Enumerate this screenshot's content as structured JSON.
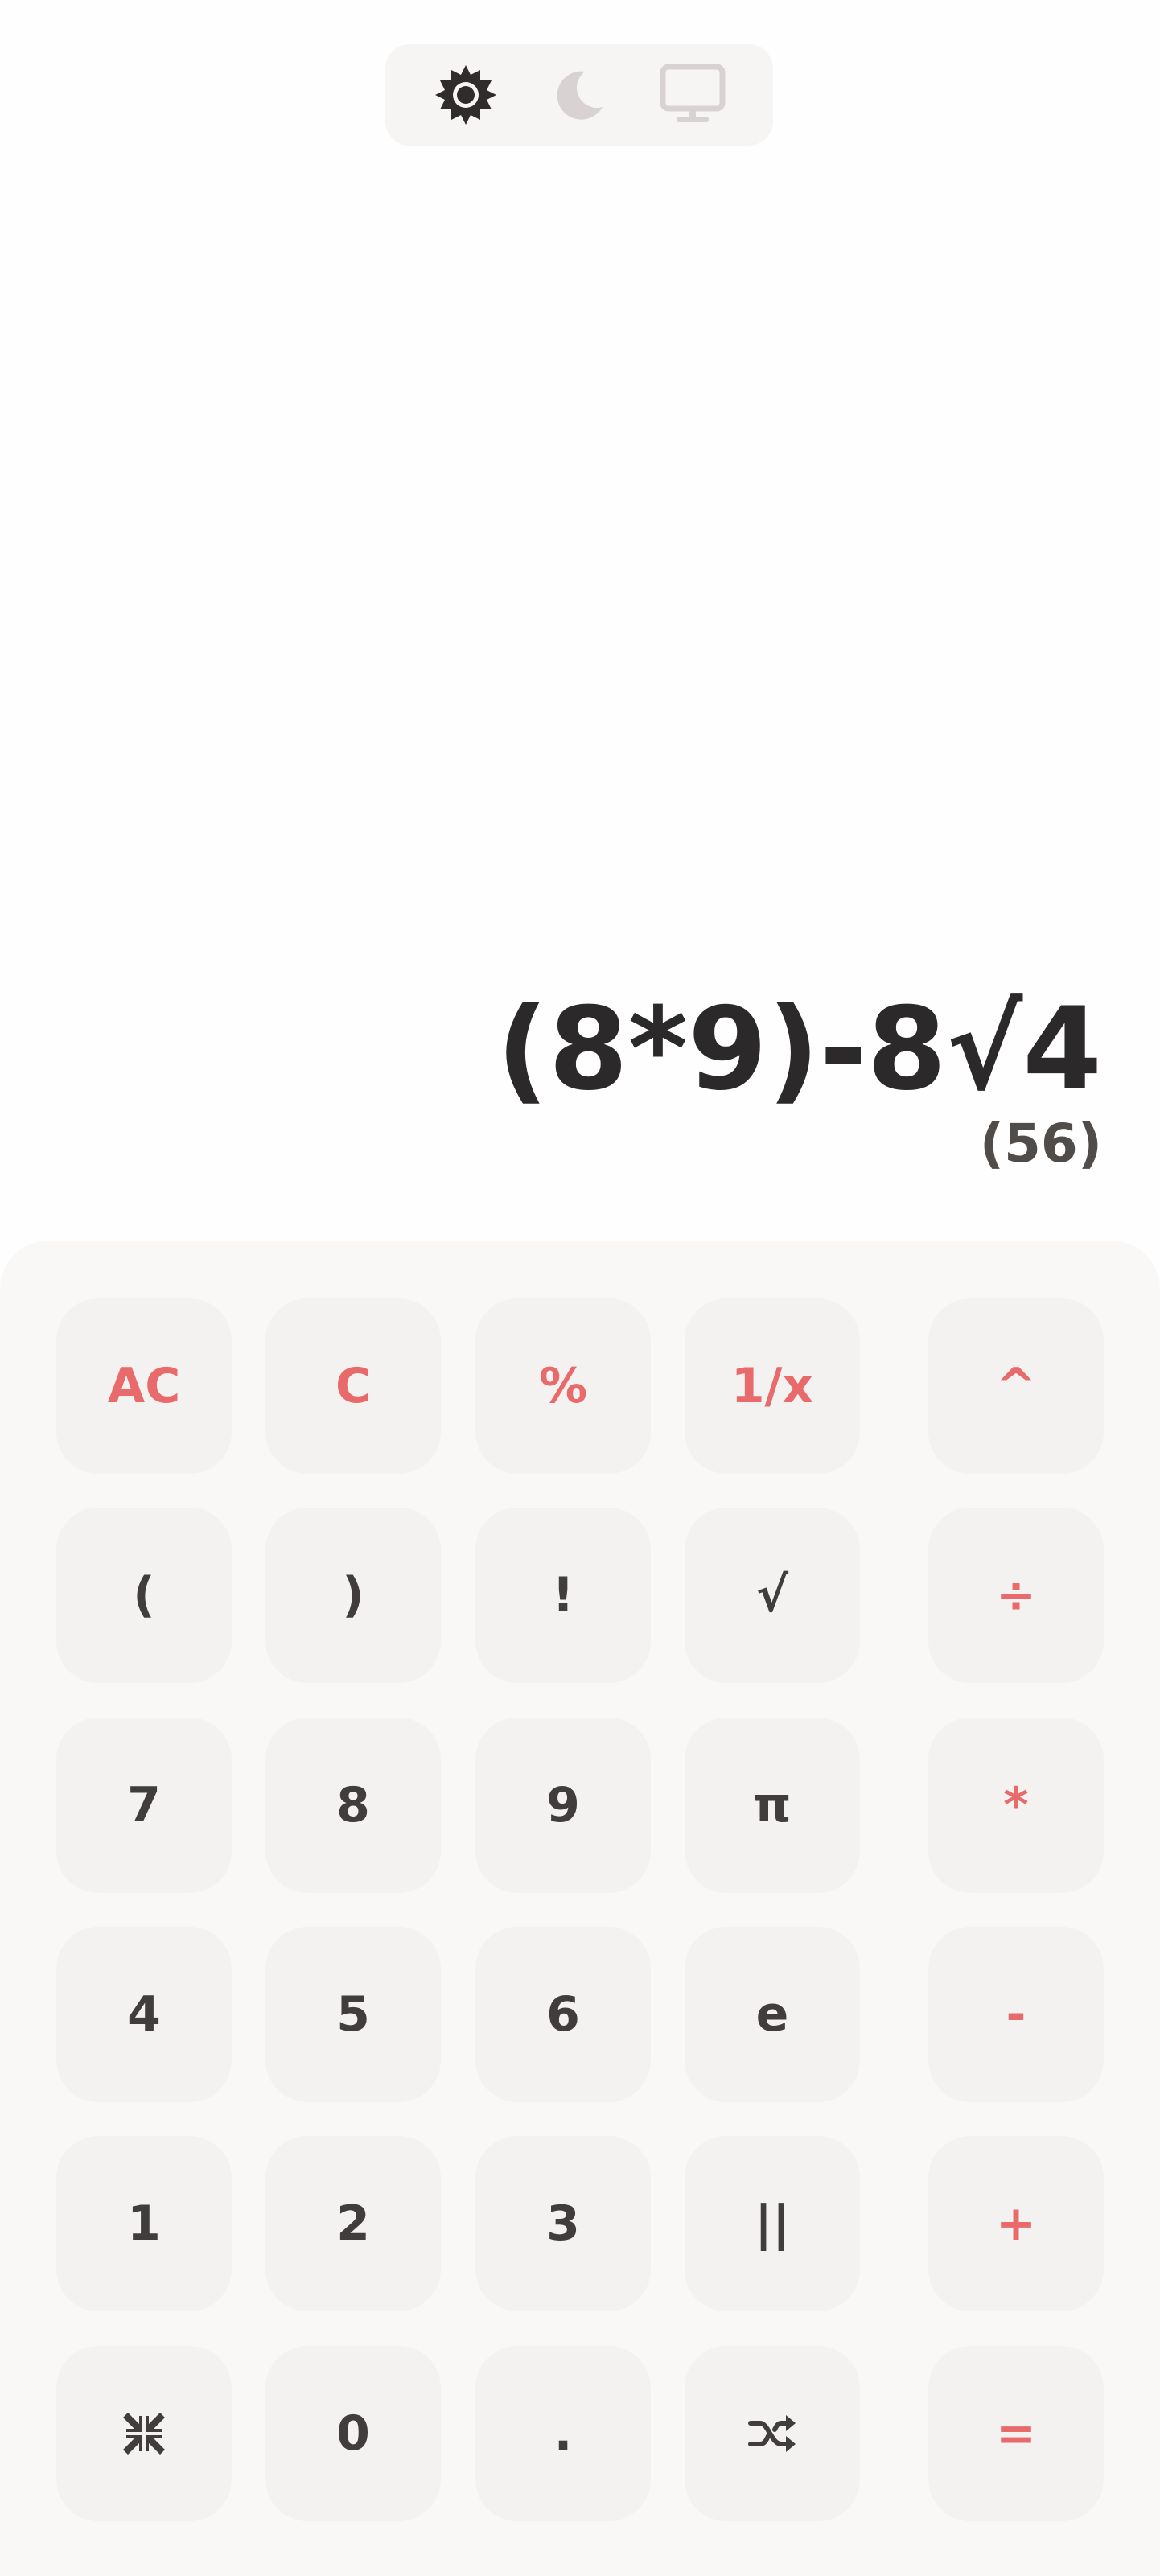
{
  "theme_switch": {
    "items": [
      {
        "icon": "sun-icon",
        "active": true
      },
      {
        "icon": "moon-icon",
        "active": false
      },
      {
        "icon": "monitor-icon",
        "active": false
      }
    ]
  },
  "display": {
    "expression": "(8*9)-8√4",
    "result": "(56)"
  },
  "colors": {
    "accent": "#e86a6a",
    "key_text": "#403d3c",
    "key_bg": "#f3f2f1",
    "expression": "#2b2929",
    "result": "#504c4a"
  },
  "keypad": {
    "rows": [
      [
        "AC",
        "C",
        "%",
        "1/x",
        "^"
      ],
      [
        "(",
        ")",
        "!",
        "√",
        "÷"
      ],
      [
        "7",
        "8",
        "9",
        "π",
        "*"
      ],
      [
        "4",
        "5",
        "6",
        "e",
        "-"
      ],
      [
        "1",
        "2",
        "3",
        "||",
        "+"
      ],
      [
        "",
        "0",
        ".",
        "",
        "="
      ]
    ],
    "icon_keys": {
      "collapse": "collapse-icon",
      "shuffle": "shuffle-icon"
    }
  }
}
